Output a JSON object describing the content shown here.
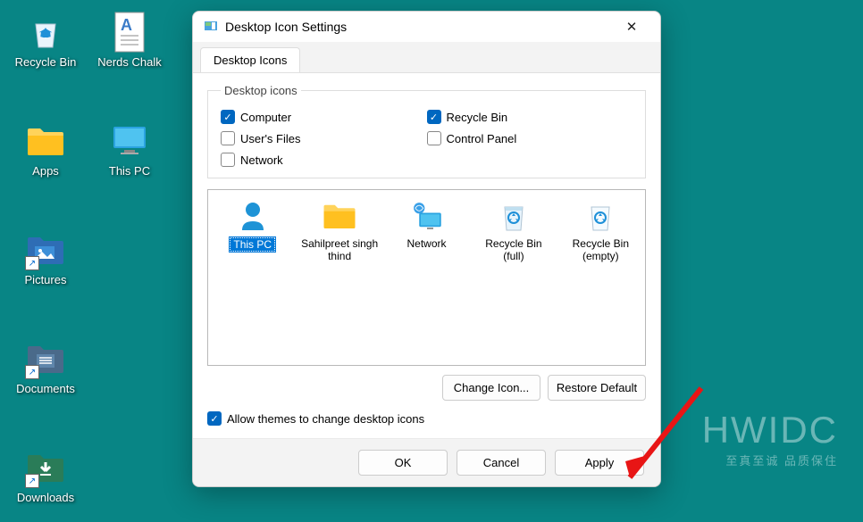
{
  "desktop_icons": [
    {
      "label": "Recycle Bin"
    },
    {
      "label": "Nerds Chalk"
    },
    {
      "label": "Apps"
    },
    {
      "label": "This PC"
    },
    {
      "label": "Pictures"
    },
    {
      "label": "Documents"
    },
    {
      "label": "Downloads"
    }
  ],
  "dialog": {
    "title": "Desktop Icon Settings",
    "tab": "Desktop Icons",
    "fieldset_legend": "Desktop icons",
    "checks": {
      "computer": {
        "label": "Computer",
        "checked": true
      },
      "recyclebin": {
        "label": "Recycle Bin",
        "checked": true
      },
      "userfiles": {
        "label": "User's Files",
        "checked": false
      },
      "controlpanel": {
        "label": "Control Panel",
        "checked": false
      },
      "network": {
        "label": "Network",
        "checked": false
      }
    },
    "iconlist": [
      {
        "label": "This PC",
        "selected": true
      },
      {
        "label": "Sahilpreet singh thind",
        "selected": false
      },
      {
        "label": "Network",
        "selected": false
      },
      {
        "label": "Recycle Bin (full)",
        "selected": false
      },
      {
        "label": "Recycle Bin (empty)",
        "selected": false
      }
    ],
    "buttons": {
      "change_icon": "Change Icon...",
      "restore_default": "Restore Default",
      "allow_themes": "Allow themes to change desktop icons",
      "ok": "OK",
      "cancel": "Cancel",
      "apply": "Apply"
    }
  },
  "watermark": {
    "big": "HWIDC",
    "small": "至真至诚 品质保住"
  }
}
